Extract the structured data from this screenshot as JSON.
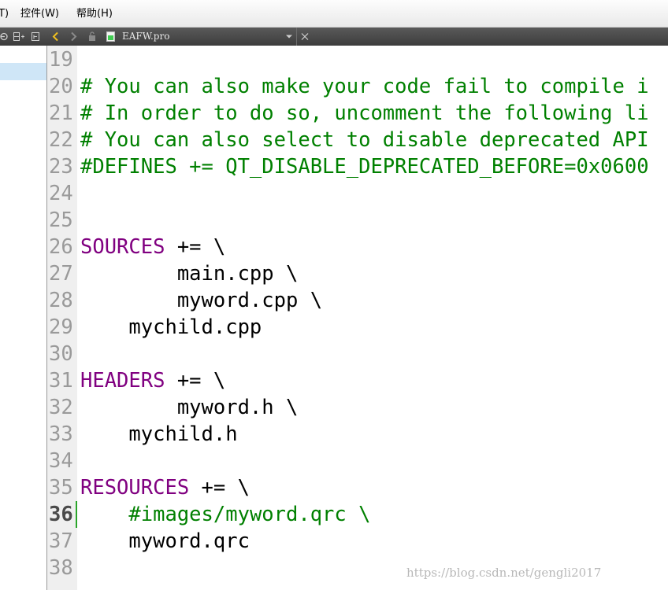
{
  "menu": {
    "items": [
      {
        "id": "partial",
        "label": "T)"
      },
      {
        "id": "controls",
        "label": "控件(W)"
      },
      {
        "id": "help",
        "label": "帮助(H)"
      }
    ]
  },
  "toolbar": {
    "file_name": "EAFW.pro",
    "icons": [
      "sync-icon",
      "split-icon",
      "add-split-icon",
      "back-icon",
      "forward-icon",
      "lock-icon",
      "pro-file-icon",
      "dropdown-arrow-icon",
      "close-icon"
    ]
  },
  "editor": {
    "current_line": "36",
    "lines": [
      {
        "n": "19",
        "segs": []
      },
      {
        "n": "20",
        "segs": [
          {
            "c": "comment",
            "t": "# You can also make your code fail to compile i"
          }
        ]
      },
      {
        "n": "21",
        "segs": [
          {
            "c": "comment",
            "t": "# In order to do so, uncomment the following li"
          }
        ]
      },
      {
        "n": "22",
        "segs": [
          {
            "c": "comment",
            "t": "# You can also select to disable deprecated API"
          }
        ]
      },
      {
        "n": "23",
        "segs": [
          {
            "c": "comment",
            "t": "#DEFINES += QT_DISABLE_DEPRECATED_BEFORE=0x0600"
          }
        ]
      },
      {
        "n": "24",
        "segs": []
      },
      {
        "n": "25",
        "segs": []
      },
      {
        "n": "26",
        "segs": [
          {
            "c": "kw",
            "t": "SOURCES"
          },
          {
            "c": "plain",
            "t": " += \\"
          }
        ]
      },
      {
        "n": "27",
        "segs": [
          {
            "c": "plain",
            "t": "        main.cpp \\"
          }
        ]
      },
      {
        "n": "28",
        "segs": [
          {
            "c": "plain",
            "t": "        myword.cpp \\"
          }
        ]
      },
      {
        "n": "29",
        "segs": [
          {
            "c": "plain",
            "t": "    mychild.cpp"
          }
        ]
      },
      {
        "n": "30",
        "segs": []
      },
      {
        "n": "31",
        "segs": [
          {
            "c": "kw",
            "t": "HEADERS"
          },
          {
            "c": "plain",
            "t": " += \\"
          }
        ]
      },
      {
        "n": "32",
        "segs": [
          {
            "c": "plain",
            "t": "        myword.h \\"
          }
        ]
      },
      {
        "n": "33",
        "segs": [
          {
            "c": "plain",
            "t": "    mychild.h"
          }
        ]
      },
      {
        "n": "34",
        "segs": []
      },
      {
        "n": "35",
        "segs": [
          {
            "c": "kw",
            "t": "RESOURCES"
          },
          {
            "c": "plain",
            "t": " += \\"
          }
        ]
      },
      {
        "n": "36",
        "segs": [
          {
            "c": "plain",
            "t": "    "
          },
          {
            "c": "comment",
            "t": "#images/myword.qrc \\"
          }
        ]
      },
      {
        "n": "37",
        "segs": [
          {
            "c": "plain",
            "t": "    myword.qrc"
          }
        ]
      },
      {
        "n": "38",
        "segs": []
      }
    ]
  },
  "watermark": "https://blog.csdn.net/gengli2017",
  "colors": {
    "comment": "#008000",
    "keyword": "#800080",
    "text": "#000000",
    "line_number": "#9a9a9a"
  }
}
